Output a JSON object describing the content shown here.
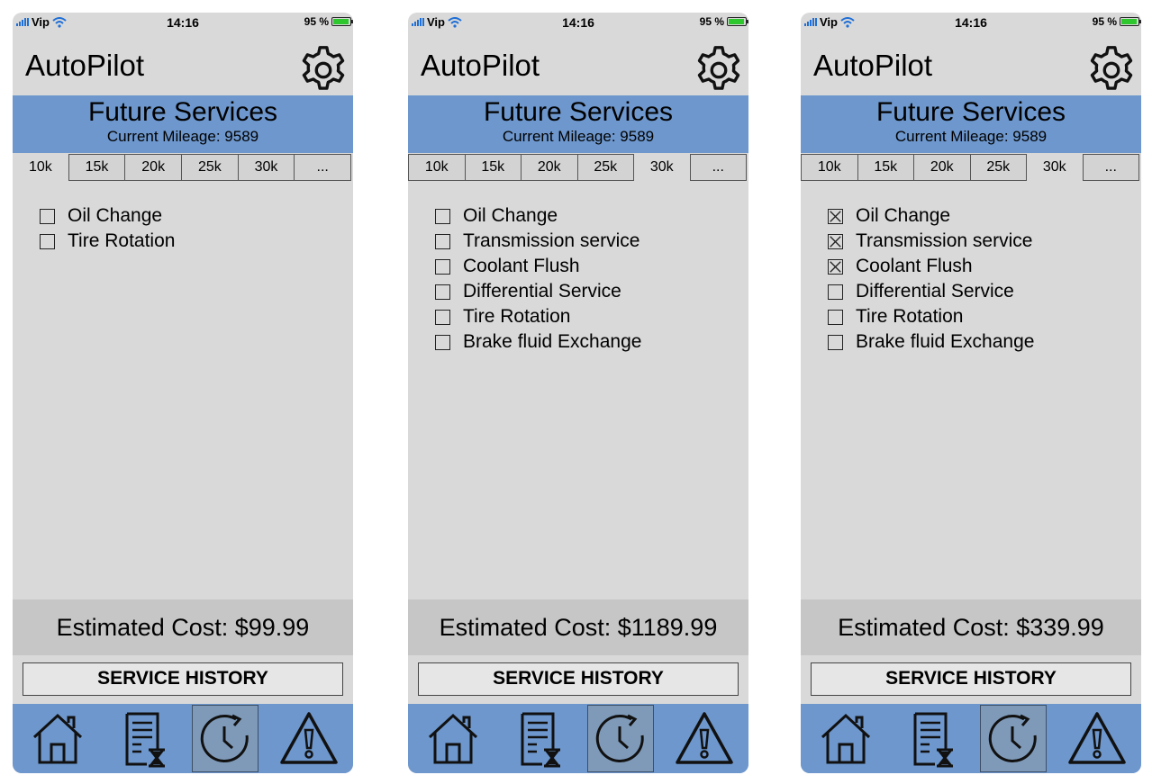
{
  "status_bar": {
    "carrier": "Vip",
    "time": "14:16",
    "battery": "95 %",
    "battery_level": 0.95
  },
  "colors": {
    "banner": "#6d97cd",
    "nav": "#6d97cd",
    "background": "#d9d9d9",
    "cost_bar": "#c6c6c6"
  },
  "screens": [
    {
      "app_title": "AutoPilot",
      "banner_title": "Future Services",
      "mileage": "Current Mileage: 9589",
      "tabs": [
        "10k",
        "15k",
        "20k",
        "25k",
        "30k",
        "..."
      ],
      "active_tab": "10k",
      "services": [
        {
          "label": "Oil Change",
          "checked": false
        },
        {
          "label": "Tire Rotation",
          "checked": false
        }
      ],
      "cost": "Estimated Cost: $99.99",
      "history_button": "SERVICE HISTORY",
      "nav": [
        "home-icon",
        "service-schedule-icon",
        "history-clock-icon",
        "alert-icon"
      ],
      "active_nav": "history-clock-icon"
    },
    {
      "app_title": "AutoPilot",
      "banner_title": "Future Services",
      "mileage": "Current Mileage: 9589",
      "tabs": [
        "10k",
        "15k",
        "20k",
        "25k",
        "30k",
        "..."
      ],
      "active_tab": "30k",
      "services": [
        {
          "label": "Oil Change",
          "checked": false
        },
        {
          "label": "Transmission service",
          "checked": false
        },
        {
          "label": "Coolant Flush",
          "checked": false
        },
        {
          "label": "Differential Service",
          "checked": false
        },
        {
          "label": "Tire Rotation",
          "checked": false
        },
        {
          "label": "Brake fluid Exchange",
          "checked": false
        }
      ],
      "cost": "Estimated Cost: $1189.99",
      "history_button": "SERVICE HISTORY",
      "nav": [
        "home-icon",
        "service-schedule-icon",
        "history-clock-icon",
        "alert-icon"
      ],
      "active_nav": "history-clock-icon"
    },
    {
      "app_title": "AutoPilot",
      "banner_title": "Future Services",
      "mileage": "Current Mileage: 9589",
      "tabs": [
        "10k",
        "15k",
        "20k",
        "25k",
        "30k",
        "..."
      ],
      "active_tab": "30k",
      "services": [
        {
          "label": "Oil Change",
          "checked": true
        },
        {
          "label": "Transmission service",
          "checked": true
        },
        {
          "label": "Coolant Flush",
          "checked": true
        },
        {
          "label": "Differential Service",
          "checked": false
        },
        {
          "label": "Tire Rotation",
          "checked": false
        },
        {
          "label": "Brake fluid Exchange",
          "checked": false
        }
      ],
      "cost": "Estimated Cost: $339.99",
      "history_button": "SERVICE HISTORY",
      "nav": [
        "home-icon",
        "service-schedule-icon",
        "history-clock-icon",
        "alert-icon"
      ],
      "active_nav": "history-clock-icon"
    }
  ]
}
